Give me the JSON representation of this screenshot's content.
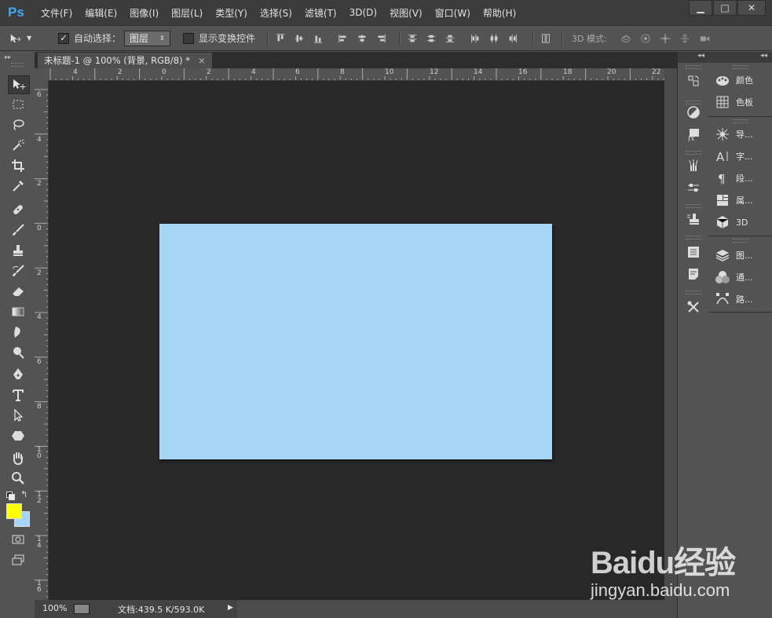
{
  "app": {
    "logo": "Ps"
  },
  "menu": [
    "文件(F)",
    "编辑(E)",
    "图像(I)",
    "图层(L)",
    "类型(Y)",
    "选择(S)",
    "滤镜(T)",
    "3D(D)",
    "视图(V)",
    "窗口(W)",
    "帮助(H)"
  ],
  "window_controls": {
    "minimize": "▁",
    "maximize": "□",
    "close": "✕"
  },
  "options_bar": {
    "auto_select_label": "自动选择：",
    "auto_select_checked": true,
    "auto_select_target": "图层",
    "show_transform_label": "显示变换控件",
    "show_transform_checked": false,
    "mode_3d_label": "3D 模式:"
  },
  "document": {
    "tab_title": "未标题-1 @ 100% (背景, RGB/8) *",
    "tab_close": "×",
    "image_fill_color": "#a6d6f5",
    "ruler_h_labels": [
      "4",
      "2",
      "0",
      "2",
      "4",
      "6",
      "8",
      "10",
      "12",
      "14",
      "16",
      "18",
      "20",
      "22"
    ],
    "ruler_v_labels": [
      "6",
      "4",
      "2",
      "0",
      "2",
      "4",
      "6",
      "8",
      "10",
      "12",
      "14",
      "16"
    ]
  },
  "status": {
    "zoom": "100%",
    "doc_info": "文档:439.5 K/593.0K",
    "arrow": "▶"
  },
  "colors": {
    "foreground": "#ffff00",
    "background": "#a6d6f5",
    "accent": "#3da8f5"
  },
  "panels_right": [
    {
      "icon": "palette-icon",
      "label": "颜色"
    },
    {
      "icon": "swatches-icon",
      "label": "色板"
    },
    {
      "icon": "navigator-icon",
      "label": "导..."
    },
    {
      "icon": "character-icon",
      "label": "字..."
    },
    {
      "icon": "paragraph-icon",
      "label": "段..."
    },
    {
      "icon": "properties-icon",
      "label": "属..."
    },
    {
      "icon": "3d-icon",
      "label": "3D"
    },
    {
      "icon": "layers-icon",
      "label": "图..."
    },
    {
      "icon": "channels-icon",
      "label": "通..."
    },
    {
      "icon": "paths-icon",
      "label": "路..."
    }
  ],
  "watermark": {
    "logo_text": "Baidu经验",
    "url": "jingyan.baidu.com"
  }
}
